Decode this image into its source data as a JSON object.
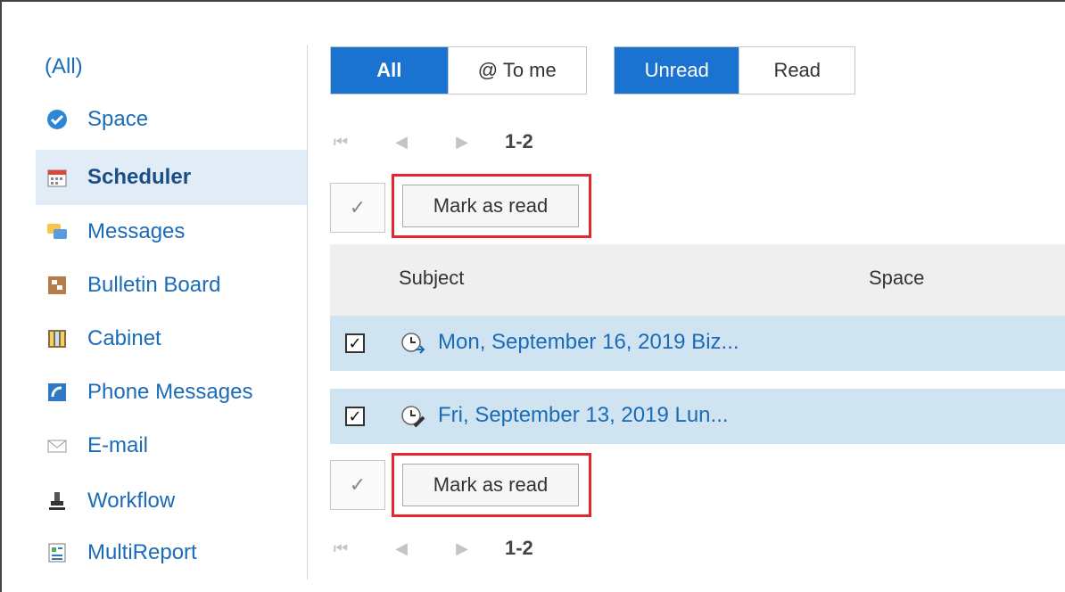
{
  "sidebar": {
    "items": [
      {
        "label": "(All)",
        "icon": "none",
        "selected": false
      },
      {
        "label": "Space",
        "icon": "space-icon",
        "selected": false
      },
      {
        "label": "Scheduler",
        "icon": "calendar-icon",
        "selected": true
      },
      {
        "label": "Messages",
        "icon": "speech-bubbles-icon",
        "selected": false
      },
      {
        "label": "Bulletin Board",
        "icon": "bulletin-board-icon",
        "selected": false
      },
      {
        "label": "Cabinet",
        "icon": "cabinet-icon",
        "selected": false
      },
      {
        "label": "Phone Messages",
        "icon": "phone-icon",
        "selected": false
      },
      {
        "label": "E-mail",
        "icon": "envelope-icon",
        "selected": false
      },
      {
        "label": "Workflow",
        "icon": "stamp-icon",
        "selected": false
      },
      {
        "label": "MultiReport",
        "icon": "report-icon",
        "selected": false
      }
    ]
  },
  "filters": {
    "scope": {
      "all": "All",
      "to_me": "@ To me",
      "active": "All"
    },
    "status": {
      "unread": "Unread",
      "read": "Read",
      "active": "Unread"
    }
  },
  "pager": {
    "range": "1-2"
  },
  "actions": {
    "mark_as_read": "Mark as read",
    "check_all_glyph": "✓"
  },
  "table": {
    "columns": {
      "subject": "Subject",
      "space": "Space"
    },
    "rows": [
      {
        "checked": true,
        "icon": "clock-arrow-icon",
        "subject": "Mon, September 16, 2019 Biz...",
        "space": ""
      },
      {
        "checked": true,
        "icon": "clock-pencil-icon",
        "subject": "Fri, September 13, 2019 Lun...",
        "space": ""
      }
    ]
  },
  "colors": {
    "accent": "#1a73d0",
    "link": "#1a6bb8",
    "highlight": "#e6262e",
    "row_selected": "#cfe3f1",
    "sidebar_selected": "#e1ecf6"
  }
}
